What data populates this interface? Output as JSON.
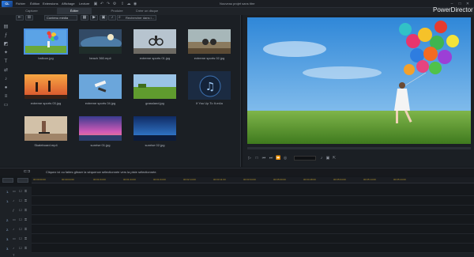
{
  "app": {
    "logo": "CL",
    "brand": "PowerDirector",
    "project_name": "Nouveau projet sans titre"
  },
  "menu": [
    "Fichier",
    "Édition",
    "Extensions",
    "Affichage",
    "Lecture"
  ],
  "tabs": [
    "Capturer",
    "Éditer",
    "Produire",
    "Créer un disque"
  ],
  "library": {
    "filter_value": "Contenu média",
    "search_placeholder": "Rechercher dans l...",
    "items": [
      {
        "label": "balloon.jpg",
        "type": "balloon",
        "selected": true
      },
      {
        "label": "beach 360.mp4",
        "type": "beach"
      },
      {
        "label": "extreme sports 01.jpg",
        "type": "bike"
      },
      {
        "label": "extreme sports 02.jpg",
        "type": "moto"
      },
      {
        "label": "extreme sports 03.jpg",
        "type": "sunset"
      },
      {
        "label": "extreme sports 04.jpg",
        "type": "skydive"
      },
      {
        "label": "grassland.jpg",
        "type": "grass"
      },
      {
        "label": "If You Up To It.m4a",
        "type": "music"
      },
      {
        "label": "Skateboard.mp4",
        "type": "skate"
      },
      {
        "label": "sunrise 01.jpg",
        "type": "sunrise1"
      },
      {
        "label": "sunrise 02.jpg",
        "type": "sunrise2"
      }
    ]
  },
  "timeline": {
    "hint": "Cliquez ici ou faites glisser la séquence sélectionnée vers la piste sélectionnée.",
    "ticks": [
      "00:00:00:00",
      "00:00:04:00",
      "00:01:04:00",
      "00:01:44:00",
      "00:01:04:00",
      "00:02:14:00",
      "00:03:11:00",
      "00:03:34:00",
      "00:05:00:00",
      "00:04:48:00",
      "00:05:04:00",
      "00:05:14:00",
      "00:05:44:00"
    ],
    "tracks": [
      "1.",
      "1.",
      "",
      "2.",
      "2.",
      "3.",
      "3.",
      ""
    ]
  },
  "colors": {
    "accent": "#4a90e2",
    "tick": "#b0922f"
  }
}
